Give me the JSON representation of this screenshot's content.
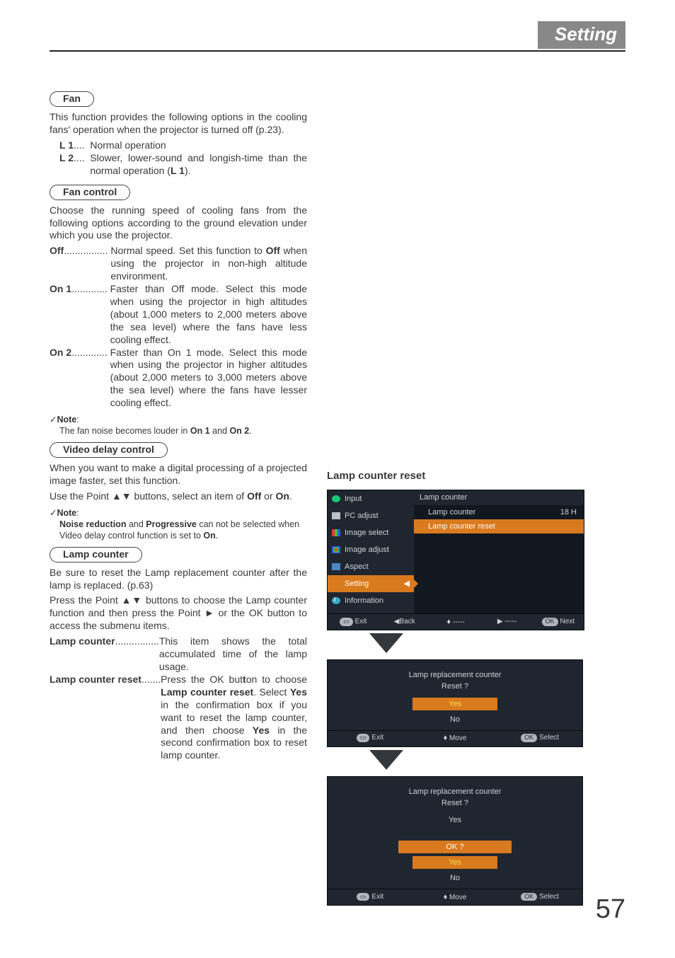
{
  "header": {
    "title": "Setting"
  },
  "page_number": "57",
  "fan": {
    "heading": "Fan",
    "intro": "This function provides the following options in the cooling fans' operation when the projector is turned off (p.23).",
    "L1_label": "L 1",
    "L1_dots": "....  ",
    "L1_desc": "Normal operation",
    "L2_label": "L 2",
    "L2_dots": "....  ",
    "L2_desc_1": "Slower, lower-sound and longish-time than the normal operation (",
    "L2_desc_bold": "L 1",
    "L2_desc_2": ")."
  },
  "fan_control": {
    "heading": "Fan control",
    "intro": "Choose the running speed of cooling fans from the following options according to the ground elevation under which you use the projector.",
    "off_label": "Off",
    "off_dots": "................ ",
    "off_desc_1": "Normal speed. Set this function to ",
    "off_desc_bold": "Off",
    "off_desc_2": " when using the projector in non-high altitude environment.",
    "on1_label": "On 1",
    "on1_dots": "............. ",
    "on1_desc": "Faster than Off mode. Select this mode when using the projector in high altitudes (about 1,000 meters to 2,000 meters above the sea level) where the fans have less cooling effect.",
    "on2_label": "On 2",
    "on2_dots": "............. ",
    "on2_desc": "Faster than On 1 mode. Select this mode when using the projector in higher altitudes (about 2,000 meters to 3,000 meters above the sea level) where the fans have lesser cooling effect.",
    "note_label": "Note",
    "note_text_1": "The fan noise becomes louder in ",
    "note_b1": "On 1",
    "note_text_2": " and ",
    "note_b2": "On 2",
    "note_text_3": "."
  },
  "video_delay": {
    "heading": "Video delay control",
    "p1": "When you want to make a digital processing of a projected image faster, set this function.",
    "p2_1": "Use the Point ▲▼ buttons, select an item of ",
    "p2_b1": "Off",
    "p2_2": " or ",
    "p2_b2": "On",
    "p2_3": ".",
    "note_label": "Note",
    "note_b1": "Noise reduction",
    "note_mid": " and ",
    "note_b2": "Progressive",
    "note_rest": " can not be selected when Video delay control function is set to ",
    "note_b3": "On",
    "note_end": "."
  },
  "lamp": {
    "heading": "Lamp counter",
    "p1": "Be sure to reset the Lamp replacement counter after the lamp is replaced. (p.63)",
    "p2": "Press the Point ▲▼ buttons to choose the Lamp counter function and then press the Point ► or the OK button to access the submenu items.",
    "lc_label": "Lamp counter",
    "lc_dots": "................",
    "lc_desc": "This item shows the total accumulated time of the lamp usage.",
    "lcr_label": "Lamp counter reset",
    "lcr_dots": ".......",
    "lcr_1": "Press the OK but",
    "lcr_1b": "t",
    "lcr_2": "on to choose ",
    "lcr_b1": "Lamp counter reset",
    "lcr_3": ". Select ",
    "lcr_b2": "Yes",
    "lcr_4": " in the confirmation box if you want to reset the lamp counter, and then choose ",
    "lcr_b3": "Yes",
    "lcr_5": " in the second confirmation box to reset lamp counter."
  },
  "right": {
    "title": "Lamp counter reset",
    "menu": {
      "items": [
        "Input",
        "PC adjust",
        "Image select",
        "Image adjust",
        "Aspect",
        "Setting",
        "Information"
      ],
      "main_title": "Lamp counter",
      "row1_label": "Lamp counter",
      "row1_value": "18 H",
      "row2_label": "Lamp counter reset",
      "foot": {
        "exit": "Exit",
        "back": "Back",
        "move": "-----",
        "sel": "-----",
        "next": "Next"
      }
    },
    "dialog1": {
      "line1": "Lamp replacement counter",
      "line2": "Reset ?",
      "yes": "Yes",
      "no": "No",
      "foot_exit": "Exit",
      "foot_move": "Move",
      "foot_sel": "Select"
    },
    "dialog2": {
      "line1": "Lamp replacement counter",
      "line2": "Reset ?",
      "first_yes": "Yes",
      "ok": "OK ?",
      "yes": "Yes",
      "no": "No",
      "foot_exit": "Exit",
      "foot_move": "Move",
      "foot_sel": "Select"
    }
  }
}
